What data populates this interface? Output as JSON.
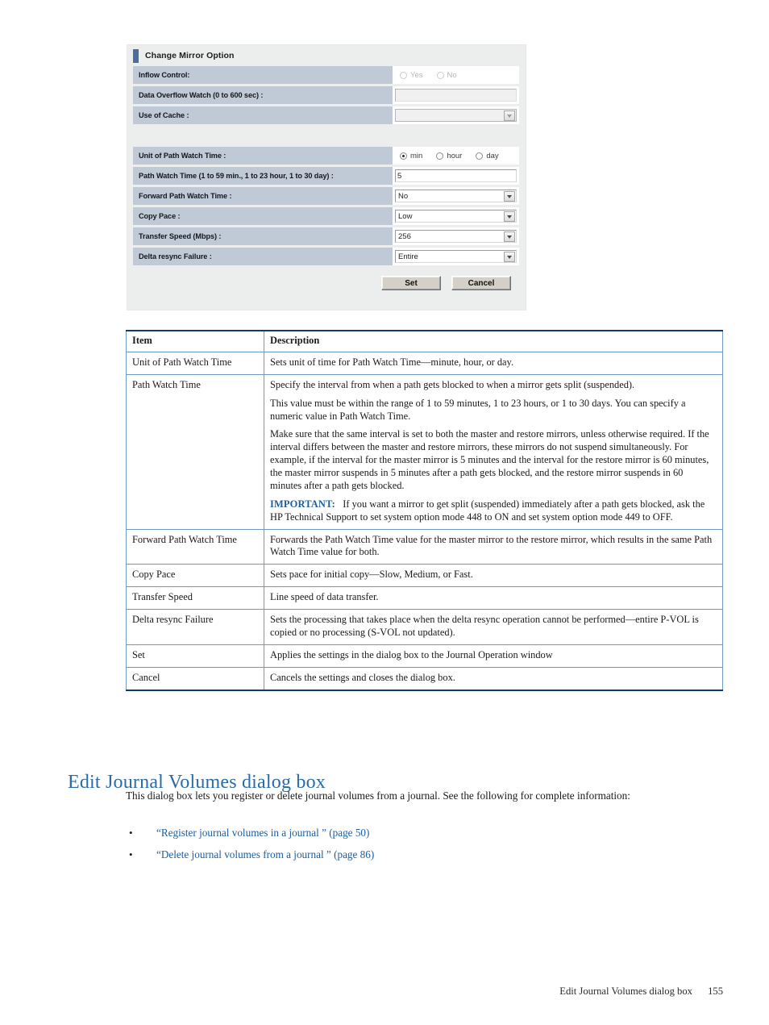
{
  "dialog": {
    "title": "Change Mirror Option",
    "rows": [
      {
        "label": "Inflow Control:",
        "control": "radio",
        "disabled": true,
        "options": [
          {
            "label": "Yes",
            "checked": false
          },
          {
            "label": "No",
            "checked": false
          }
        ]
      },
      {
        "label": "Data Overflow Watch (0 to 600 sec) :",
        "control": "text",
        "disabled": true,
        "value": "",
        "placeholder": ""
      },
      {
        "label": "Use of Cache :",
        "control": "select",
        "disabled": true,
        "value": ""
      },
      {
        "label": "Unit of Path Watch Time :",
        "control": "radio",
        "disabled": false,
        "options": [
          {
            "label": "min",
            "checked": true
          },
          {
            "label": "hour",
            "checked": false
          },
          {
            "label": "day",
            "checked": false
          }
        ]
      },
      {
        "label": "Path Watch Time (1 to 59 min., 1 to 23 hour, 1 to 30 day) :",
        "control": "text",
        "disabled": false,
        "value": "5",
        "placeholder": ""
      },
      {
        "label": "Forward Path Watch Time :",
        "control": "select",
        "disabled": false,
        "value": "No"
      },
      {
        "label": "Copy Pace :",
        "control": "select",
        "disabled": false,
        "value": "Low"
      },
      {
        "label": "Transfer Speed (Mbps) :",
        "control": "select",
        "disabled": false,
        "value": "256"
      },
      {
        "label": "Delta resync Failure :",
        "control": "select",
        "disabled": false,
        "value": "Entire"
      }
    ],
    "buttons": {
      "set": "Set",
      "cancel": "Cancel"
    },
    "accent_color": "#4a6d9c",
    "label_bg": "#c0c9d6"
  },
  "table": {
    "headers": {
      "item": "Item",
      "description": "Description"
    },
    "rows": [
      {
        "item": "Unit of Path Watch Time",
        "paragraphs": [
          "Sets unit of time for Path Watch Time—minute, hour, or day."
        ]
      },
      {
        "item": "Path Watch Time",
        "paragraphs": [
          "Specify the interval from when a path gets blocked to when a mirror gets split (suspended).",
          "This value must be within the range of 1 to 59 minutes, 1 to 23 hours, or 1 to 30 days. You can specify a numeric value in Path Watch Time.",
          "Make sure that the same interval is set to both the master and restore mirrors, unless otherwise required. If the interval differs between the master and restore mirrors, these mirrors do not suspend simultaneously. For example, if the interval for the master mirror is 5 minutes and the interval for the restore mirror is 60 minutes, the master mirror suspends in 5 minutes after a path gets blocked, and the restore mirror suspends in 60 minutes after a path gets blocked."
        ],
        "important_label": "IMPORTANT:",
        "important_text": "If you want a mirror to get split (suspended) immediately after a path gets blocked, ask the HP Technical Support to set system option mode 448 to ON and set system option mode 449 to OFF."
      },
      {
        "item": "Forward Path Watch Time",
        "paragraphs": [
          "Forwards the Path Watch Time value for the master mirror to the restore mirror, which results in the same Path Watch Time value for both."
        ]
      },
      {
        "item": "Copy Pace",
        "paragraphs": [
          "Sets pace for initial copy—Slow, Medium, or Fast."
        ]
      },
      {
        "item": "Transfer Speed",
        "paragraphs": [
          "Line speed of data transfer."
        ]
      },
      {
        "item": "Delta resync Failure",
        "paragraphs": [
          "Sets the processing that takes place when the delta resync operation cannot be performed—entire P-VOL is copied or no processing (S-VOL not updated)."
        ]
      },
      {
        "item": "Set",
        "paragraphs": [
          "Applies the settings in the dialog box to the Journal Operation window"
        ]
      },
      {
        "item": "Cancel",
        "paragraphs": [
          "Cancels the settings and closes the dialog box."
        ]
      }
    ]
  },
  "section": {
    "heading": "Edit Journal Volumes dialog box",
    "intro": "This dialog box lets you register or delete journal volumes from a journal. See the following for complete information:",
    "bullets": [
      {
        "marker": "•",
        "text": "“Register journal volumes in a journal ” (page 50)"
      },
      {
        "marker": "•",
        "text": "“Delete journal volumes from a journal ” (page 86)"
      }
    ]
  },
  "footer": {
    "title": "Edit Journal Volumes dialog box",
    "page": "155"
  }
}
